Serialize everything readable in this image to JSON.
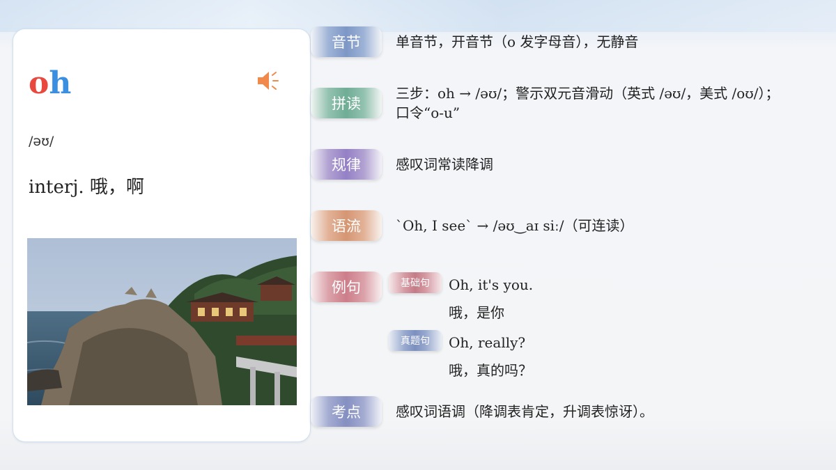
{
  "card": {
    "word_part1": "o",
    "word_part2": "h",
    "phonetic": "/əʊ/",
    "meaning": "interj. 哦，啊",
    "speaker_icon": "speaker-icon"
  },
  "rows": {
    "syllable": {
      "tag": "音节",
      "text": "单音节，开音节（o 发字母音），无静音"
    },
    "spelling": {
      "tag": "拼读",
      "line1": "三步：oh → /əʊ/；警示双元音滑动（英式 /əʊ/，美式 /oʊ/）；",
      "line2": "口令“o-u”"
    },
    "rule": {
      "tag": "规律",
      "text": "感叹词常读降调"
    },
    "flow": {
      "tag": "语流",
      "text": "`Oh, I see` → /əʊ‿aɪ siː/（可连读）"
    },
    "examples": {
      "tag": "例句",
      "basic": {
        "label": "基础句",
        "en": "Oh, it's you.",
        "zh": "哦，是你"
      },
      "exam": {
        "label": "真题句",
        "en": "Oh, really?",
        "zh": "哦，真的吗？"
      }
    },
    "exam_point": {
      "tag": "考点",
      "text": "感叹词语调（降调表肯定，升调表惊讶）。"
    }
  },
  "colors": {
    "word_o": "#e8483d",
    "word_h": "#3a8fe0",
    "speaker": "#f0894a"
  }
}
